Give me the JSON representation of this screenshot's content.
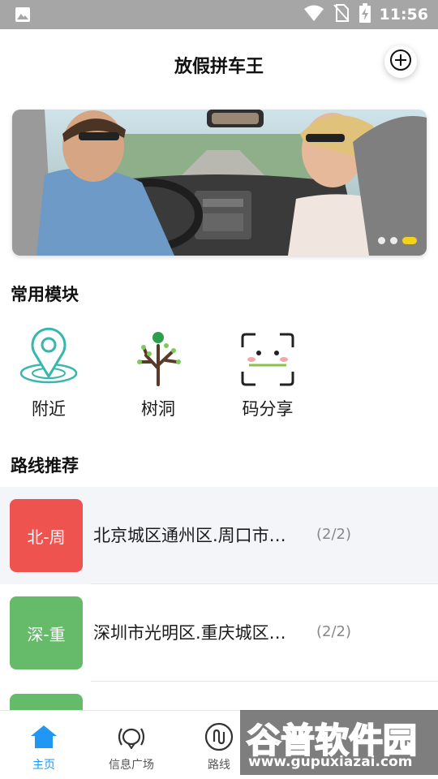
{
  "status_bar": {
    "time": "11:56",
    "icons": [
      "image-icon",
      "wifi-icon",
      "no-sim-icon",
      "battery-charging-icon"
    ]
  },
  "header": {
    "title": "放假拼车王",
    "add_icon": "plus-circle-icon"
  },
  "banner": {
    "page_count": 3,
    "active_index": 2,
    "indicator_active_color": "#f2d21b"
  },
  "modules": {
    "title": "常用模块",
    "items": [
      {
        "label": "附近",
        "icon": "location-pin-icon"
      },
      {
        "label": "树洞",
        "icon": "tree-icon"
      },
      {
        "label": "码分享",
        "icon": "scan-code-icon"
      }
    ]
  },
  "routes": {
    "title": "路线推荐",
    "items": [
      {
        "badge": "北-周",
        "text": "北京城区通州区.周口市…",
        "count": "(2/2)",
        "color": "#ef5350"
      },
      {
        "badge": "深-重",
        "text": "深圳市光明区.重庆城区…",
        "count": "(2/2)",
        "color": "#66bb6a"
      },
      {
        "badge": "",
        "text": "",
        "count": "",
        "color": "#66bb6a"
      }
    ]
  },
  "bottom_nav": {
    "items": [
      {
        "label": "主页",
        "icon": "home-icon",
        "active": true
      },
      {
        "label": "信息广场",
        "icon": "broadcast-icon",
        "active": false
      },
      {
        "label": "路线",
        "icon": "route-icon",
        "active": false
      }
    ],
    "active_color": "#2196f3"
  },
  "watermark": {
    "title": "谷普软件园",
    "url": "www.gupuxiazai.com"
  }
}
